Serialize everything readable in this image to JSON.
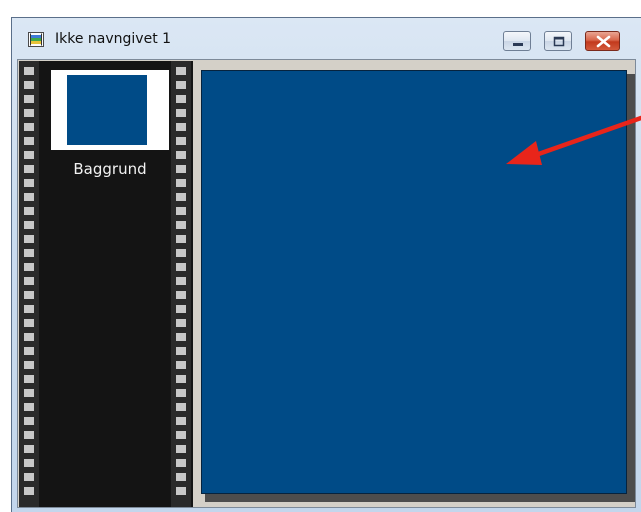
{
  "window": {
    "title": "Ikke navngivet 1",
    "icon": "image-document-icon",
    "controls": [
      "minimize-icon",
      "maximize-icon",
      "close-icon"
    ]
  },
  "filmstrip": {
    "layers": [
      {
        "label": "Baggrund",
        "thumbnail_color": "#004b87"
      }
    ]
  },
  "canvas": {
    "background_color": "#004b87"
  },
  "annotation": {
    "icon": "red-arrow",
    "color": "#e8251a"
  }
}
